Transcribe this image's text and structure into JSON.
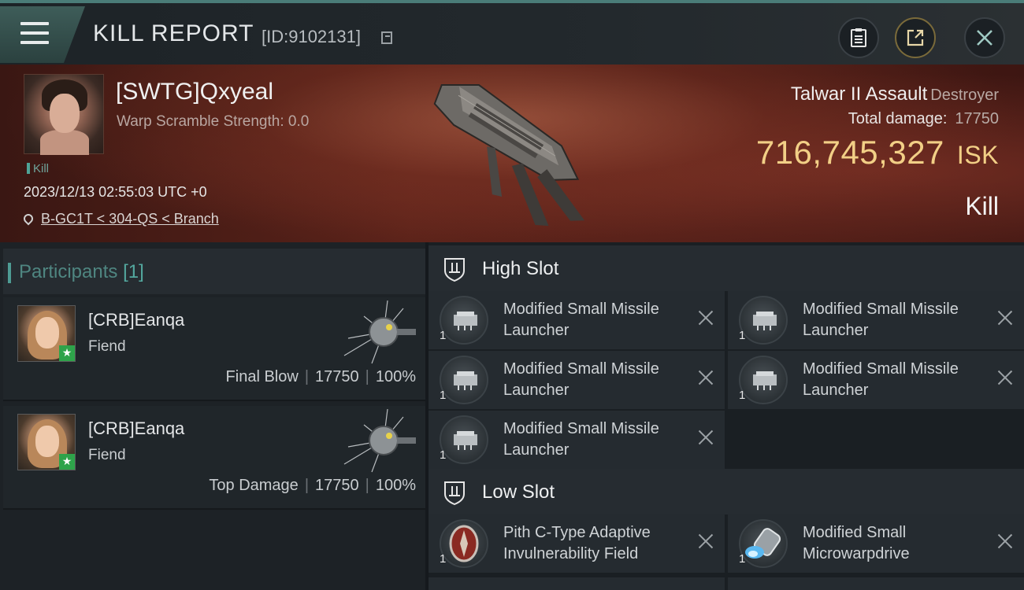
{
  "header": {
    "title": "KILL REPORT",
    "report_id": "[ID:9102131]"
  },
  "victim": {
    "name": "[SWTG]Qxyeal",
    "warp_scramble": "Warp Scramble Strength: 0.0",
    "kill_tag": "Kill",
    "timestamp": "2023/12/13 02:55:03 UTC +0",
    "location": "B-GC1T < 304-QS < Branch",
    "ship_name": "Talwar II Assault",
    "ship_class": "Destroyer",
    "total_damage_label": "Total damage:",
    "total_damage_value": "17750",
    "isk_value": "716,745,327",
    "isk_unit": "ISK",
    "result": "Kill"
  },
  "participants": {
    "label": "Participants",
    "count": "[1]",
    "rows": [
      {
        "name": "[CRB]Eanqa",
        "ship": "Fiend",
        "role": "Final Blow",
        "damage": "17750",
        "percent": "100%"
      },
      {
        "name": "[CRB]Eanqa",
        "ship": "Fiend",
        "role": "Top Damage",
        "damage": "17750",
        "percent": "100%"
      }
    ]
  },
  "slots": {
    "high_label": "High Slot",
    "low_label": "Low Slot",
    "high": [
      {
        "name": "Modified Small Missile Launcher",
        "qty": "1"
      },
      {
        "name": "Modified Small Missile Launcher",
        "qty": "1"
      },
      {
        "name": "Modified Small Missile Launcher",
        "qty": "1"
      },
      {
        "name": "Modified Small Missile Launcher",
        "qty": "1"
      },
      {
        "name": "Modified Small Missile Launcher",
        "qty": "1"
      }
    ],
    "low": [
      {
        "name": "Pith C-Type Adaptive Invulnerability Field",
        "qty": "1"
      },
      {
        "name": "Modified Small Microwarpdrive",
        "qty": "1"
      }
    ]
  },
  "colors": {
    "accent": "#4e9c94",
    "isk_gold": "#f2cf86",
    "hero_red": "#5a2219"
  },
  "icons": [
    "menu-icon",
    "copy-icon",
    "clipboard-icon",
    "share-icon",
    "close-icon",
    "location-pin-icon",
    "shield-slot-icon",
    "missile-launcher-icon",
    "shield-hardener-icon",
    "microwarpdrive-icon",
    "drone-icon"
  ]
}
